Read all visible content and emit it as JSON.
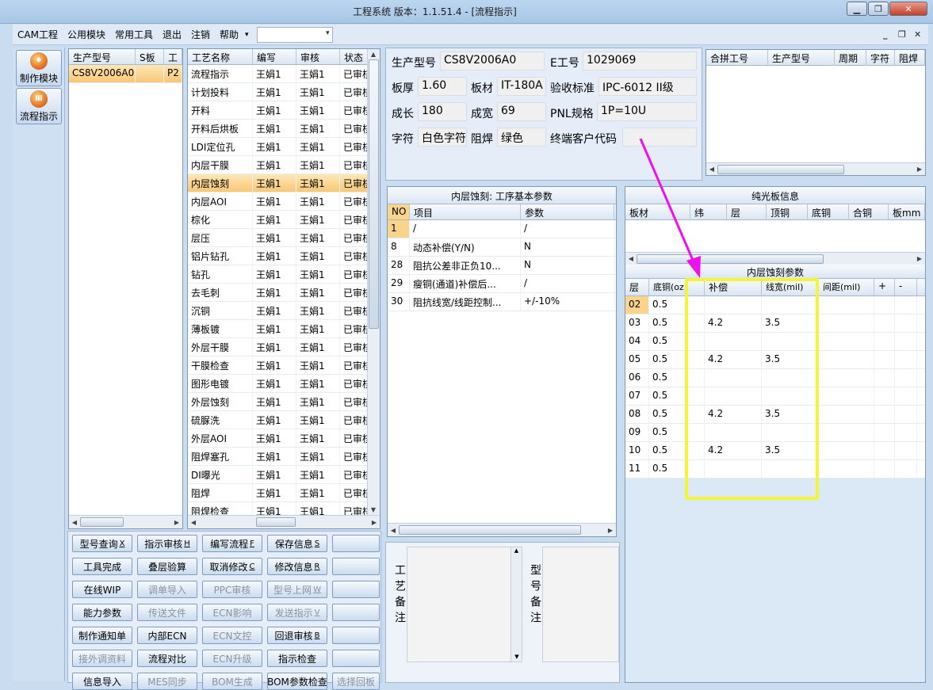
{
  "window": {
    "title": "工程系统 版本：1.1.51.4 - [流程指示]"
  },
  "menu": {
    "items": [
      "CAM工程",
      "公用模块",
      "常用工具",
      "退出",
      "注销",
      "帮助"
    ],
    "combo_value": ""
  },
  "nav": [
    {
      "label": "制作模块",
      "icon": "make-module-icon"
    },
    {
      "label": "流程指示",
      "icon": "flow-indicator-icon"
    }
  ],
  "model_list": {
    "columns": [
      "生产型号",
      "S板",
      "工"
    ],
    "rows": [
      {
        "model": "CS8V2006A0",
        "board": "",
        "process": "P2"
      }
    ]
  },
  "process_list": {
    "columns": [
      "工艺名称",
      "编写",
      "审核",
      "状态"
    ],
    "selected_index": 6,
    "rows": [
      {
        "name": "流程指示",
        "author": "王娟1",
        "reviewer": "王娟1",
        "status": "已审核"
      },
      {
        "name": "计划投料",
        "author": "王娟1",
        "reviewer": "王娟1",
        "status": "已审核"
      },
      {
        "name": "开料",
        "author": "王娟1",
        "reviewer": "王娟1",
        "status": "已审核"
      },
      {
        "name": "开料后烘板",
        "author": "王娟1",
        "reviewer": "王娟1",
        "status": "已审核"
      },
      {
        "name": "LDI定位孔",
        "author": "王娟1",
        "reviewer": "王娟1",
        "status": "已审核"
      },
      {
        "name": "内层干膜",
        "author": "王娟1",
        "reviewer": "王娟1",
        "status": "已审核"
      },
      {
        "name": "内层蚀刻",
        "author": "王娟1",
        "reviewer": "王娟1",
        "status": "已审核"
      },
      {
        "name": "内层AOI",
        "author": "王娟1",
        "reviewer": "王娟1",
        "status": "已审核"
      },
      {
        "name": "棕化",
        "author": "王娟1",
        "reviewer": "王娟1",
        "status": "已审核"
      },
      {
        "name": "层压",
        "author": "王娟1",
        "reviewer": "王娟1",
        "status": "已审核"
      },
      {
        "name": "铝片钻孔",
        "author": "王娟1",
        "reviewer": "王娟1",
        "status": "已审核"
      },
      {
        "name": "钻孔",
        "author": "王娟1",
        "reviewer": "王娟1",
        "status": "已审核"
      },
      {
        "name": "去毛刺",
        "author": "王娟1",
        "reviewer": "王娟1",
        "status": "已审核"
      },
      {
        "name": "沉铜",
        "author": "王娟1",
        "reviewer": "王娟1",
        "status": "已审核"
      },
      {
        "name": "薄板镀",
        "author": "王娟1",
        "reviewer": "王娟1",
        "status": "已审核"
      },
      {
        "name": "外层干膜",
        "author": "王娟1",
        "reviewer": "王娟1",
        "status": "已审核"
      },
      {
        "name": "干膜检查",
        "author": "王娟1",
        "reviewer": "王娟1",
        "status": "已审核"
      },
      {
        "name": "图形电镀",
        "author": "王娟1",
        "reviewer": "王娟1",
        "status": "已审核"
      },
      {
        "name": "外层蚀刻",
        "author": "王娟1",
        "reviewer": "王娟1",
        "status": "已审核"
      },
      {
        "name": "硫脲洗",
        "author": "王娟1",
        "reviewer": "王娟1",
        "status": "已审核"
      },
      {
        "name": "外层AOI",
        "author": "王娟1",
        "reviewer": "王娟1",
        "status": "已审核"
      },
      {
        "name": "阻焊塞孔",
        "author": "王娟1",
        "reviewer": "王娟1",
        "status": "已审核"
      },
      {
        "name": "DI曝光",
        "author": "王娟1",
        "reviewer": "王娟1",
        "status": "已审核"
      },
      {
        "name": "阻焊",
        "author": "王娟1",
        "reviewer": "王娟1",
        "status": "已审核"
      },
      {
        "name": "阻焊检查",
        "author": "王娟1",
        "reviewer": "王娟1",
        "status": "已审核"
      }
    ]
  },
  "buttons": [
    {
      "label": "型号查询",
      "key": "X",
      "enabled": true
    },
    {
      "label": "指示审核",
      "key": "H",
      "enabled": true
    },
    {
      "label": "编写流程",
      "key": "F",
      "enabled": true
    },
    {
      "label": "保存信息",
      "key": "S",
      "enabled": true
    },
    {
      "label": "",
      "key": "",
      "enabled": true
    },
    {
      "label": "工具完成",
      "key": "",
      "enabled": true
    },
    {
      "label": "叠层验算",
      "key": "",
      "enabled": true
    },
    {
      "label": "取消修改",
      "key": "C",
      "enabled": true
    },
    {
      "label": "修改信息",
      "key": "R",
      "enabled": true
    },
    {
      "label": "",
      "key": "",
      "enabled": true
    },
    {
      "label": "在线WIP",
      "key": "",
      "enabled": true
    },
    {
      "label": "调单导入",
      "key": "",
      "enabled": false
    },
    {
      "label": "PPC审核",
      "key": "",
      "enabled": false
    },
    {
      "label": "型号上网",
      "key": "W",
      "enabled": false
    },
    {
      "label": "",
      "key": "",
      "enabled": true
    },
    {
      "label": "能力参数",
      "key": "",
      "enabled": true
    },
    {
      "label": "传送文件",
      "key": "",
      "enabled": false
    },
    {
      "label": "ECN影响",
      "key": "",
      "enabled": false
    },
    {
      "label": "发送指示",
      "key": "V",
      "enabled": false
    },
    {
      "label": "",
      "key": "",
      "enabled": true
    },
    {
      "label": "制作通知单",
      "key": "",
      "enabled": true
    },
    {
      "label": "内部ECN",
      "key": "",
      "enabled": true
    },
    {
      "label": "ECN文控",
      "key": "",
      "enabled": false
    },
    {
      "label": "回退审核",
      "key": "B",
      "enabled": true
    },
    {
      "label": "",
      "key": "",
      "enabled": true
    },
    {
      "label": "接外调资料",
      "key": "",
      "enabled": false
    },
    {
      "label": "流程对比",
      "key": "",
      "enabled": true
    },
    {
      "label": "ECN升级",
      "key": "",
      "enabled": false
    },
    {
      "label": "指示检查",
      "key": "",
      "enabled": true
    },
    {
      "label": "",
      "key": "",
      "enabled": true
    },
    {
      "label": "信息导入",
      "key": "",
      "enabled": true
    },
    {
      "label": "MES同步",
      "key": "",
      "enabled": false
    },
    {
      "label": "BOM生成",
      "key": "",
      "enabled": false
    },
    {
      "label": "BOM参数检查",
      "key": "",
      "enabled": true
    },
    {
      "label": "选择回板",
      "key": "",
      "enabled": false
    }
  ],
  "info": {
    "model_label": "生产型号",
    "model": "CS8V2006A0",
    "eno_label": "E工号",
    "eno": "1029069",
    "thickness_label": "板厚",
    "thickness": "1.60",
    "material_label": "板材",
    "material": "IT-180A",
    "standard_label": "验收标准",
    "standard": "IPC-6012 II级",
    "length_label": "成长",
    "length": "180",
    "width_label": "成宽",
    "width": "69",
    "pnl_label": "PNL规格",
    "pnl": "1P=10U",
    "char_label": "字符",
    "char": "白色字符",
    "mask_label": "阻焊",
    "mask": "绿色",
    "customer_label": "终端客户代码",
    "customer": ""
  },
  "combined": {
    "columns": [
      "合拼工号",
      "生产型号",
      "周期",
      "字符",
      "阻焊"
    ]
  },
  "basic_params": {
    "title": "内层蚀刻: 工序基本参数",
    "columns": [
      "NO",
      "项目",
      "参数"
    ],
    "rows": [
      {
        "no": "1",
        "item": "/",
        "value": "/"
      },
      {
        "no": "8",
        "item": "动态补偿(Y/N)",
        "value": "N"
      },
      {
        "no": "28",
        "item": "阻抗公差非正负10...",
        "value": "N"
      },
      {
        "no": "29",
        "item": "瘦铜(通道)补偿后...",
        "value": "/"
      },
      {
        "no": "30",
        "item": "阻抗线宽/线距控制...",
        "value": "+/-10%"
      }
    ]
  },
  "remarks": {
    "process_label": "工艺备注",
    "model_label": "型号备注"
  },
  "board_info": {
    "title": "纯光板信息",
    "columns": [
      "板材",
      "纬",
      "层",
      "顶铜",
      "底铜",
      "合铜",
      "板mm"
    ]
  },
  "inner_etch": {
    "title": "内层蚀刻参数",
    "columns": [
      "层",
      "底铜(oz)",
      "补偿",
      "线宽(mil)",
      "间距(mil)",
      "+",
      "-"
    ],
    "rows": [
      {
        "layer": "02",
        "base": "0.5",
        "comp": "",
        "width": "",
        "spacing": ""
      },
      {
        "layer": "03",
        "base": "0.5",
        "comp": "4.2",
        "width": "3.5",
        "spacing": ""
      },
      {
        "layer": "04",
        "base": "0.5",
        "comp": "",
        "width": "",
        "spacing": ""
      },
      {
        "layer": "05",
        "base": "0.5",
        "comp": "4.2",
        "width": "3.5",
        "spacing": ""
      },
      {
        "layer": "06",
        "base": "0.5",
        "comp": "",
        "width": "",
        "spacing": ""
      },
      {
        "layer": "07",
        "base": "0.5",
        "comp": "",
        "width": "",
        "spacing": ""
      },
      {
        "layer": "08",
        "base": "0.5",
        "comp": "4.2",
        "width": "3.5",
        "spacing": ""
      },
      {
        "layer": "09",
        "base": "0.5",
        "comp": "",
        "width": "",
        "spacing": ""
      },
      {
        "layer": "10",
        "base": "0.5",
        "comp": "4.2",
        "width": "3.5",
        "spacing": ""
      },
      {
        "layer": "11",
        "base": "0.5",
        "comp": "",
        "width": "",
        "spacing": ""
      }
    ]
  },
  "colors": {
    "accent": "#f8c777",
    "highlight": "#f4f43a",
    "arrow": "#ee10ee"
  }
}
